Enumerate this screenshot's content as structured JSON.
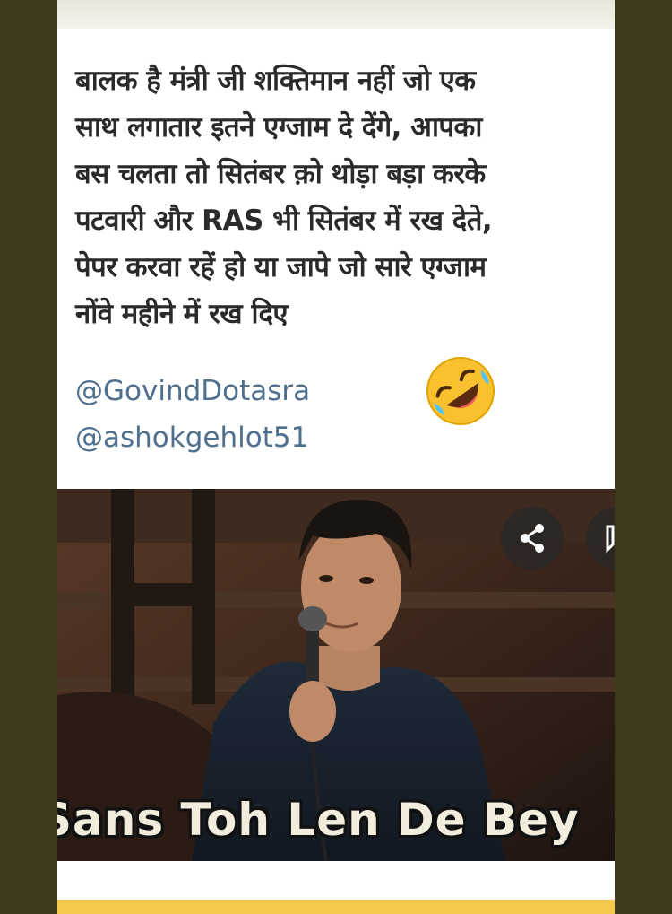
{
  "post": {
    "lines": [
      "बालक है मंत्री जी शक्तिमान नहीं जो एक",
      "साथ लगातार इतने एग्जाम दे देंगे, आपका",
      "बस चलता तो सितंबर क़ो थोड़ा बड़ा करके",
      "पटवारी और RAS भी सितंबर में रख देते,",
      "पेपर करवा रहें हो या जापे जो सारे एग्जाम",
      "नोंवे महीने में रख दिए"
    ],
    "mentions": [
      "@GovindDotasra",
      "@ashokgehlot51"
    ],
    "emoji": "rolling-on-floor-laughing-icon"
  },
  "video": {
    "caption": "Sans Toh Len De Bey",
    "share_icon": "share-icon",
    "save_icon": "bookmark-icon"
  },
  "colors": {
    "mention": "#4e6f8e",
    "frame": "#3f3b1d",
    "bottom_strip": "#f4c94a"
  }
}
